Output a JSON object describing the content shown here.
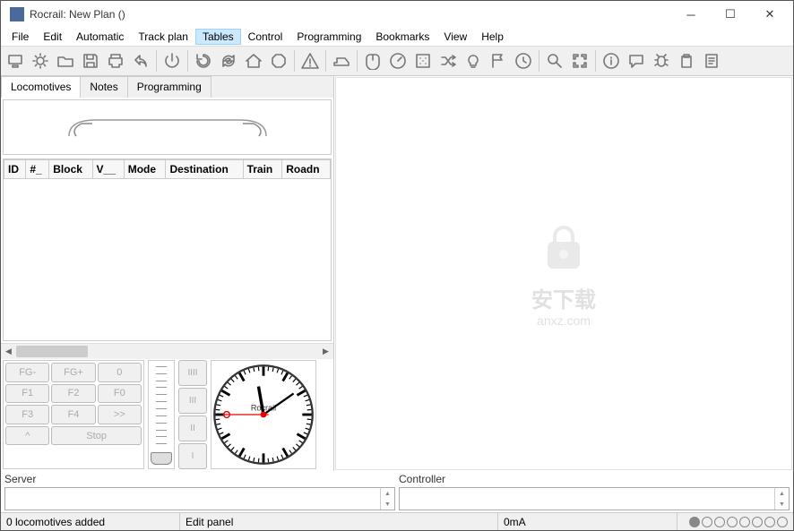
{
  "window": {
    "title": "Rocrail: New Plan ()"
  },
  "menu": {
    "items": [
      "File",
      "Edit",
      "Automatic",
      "Track plan",
      "Tables",
      "Control",
      "Programming",
      "Bookmarks",
      "View",
      "Help"
    ],
    "active_index": 4
  },
  "toolbar": {
    "icons": [
      "monitor-icon",
      "gears-icon",
      "open-icon",
      "save-icon",
      "print-icon",
      "undo-icon",
      "power-icon",
      "restart-icon",
      "sync-icon",
      "home-icon",
      "stop-icon",
      "warning-icon",
      "locomotive-icon",
      "mouse-icon",
      "gauge-icon",
      "dice-icon",
      "shuffle-icon",
      "light-icon",
      "flag-icon",
      "clock-icon",
      "zoom-icon",
      "fit-icon",
      "info-icon",
      "chat-icon",
      "bug-icon",
      "clipboard-icon",
      "notes-icon"
    ]
  },
  "tabs": {
    "items": [
      "Locomotives",
      "Notes",
      "Programming"
    ],
    "active_index": 0
  },
  "table": {
    "columns": [
      "ID",
      "#_",
      "Block",
      "V__",
      "Mode",
      "Destination",
      "Train",
      "Roadn"
    ]
  },
  "fn_buttons": {
    "fg_minus": "FG-",
    "fg_plus": "FG+",
    "zero": "0",
    "f1": "F1",
    "f2": "F2",
    "f0": "F0",
    "f3": "F3",
    "f4": "F4",
    "fwd": ">>",
    "caret": "^",
    "stop": "Stop"
  },
  "dir_buttons": [
    "IIII",
    "III",
    "II",
    "I"
  ],
  "clock": {
    "brand": "Rocrail"
  },
  "watermark": {
    "text": "安下载",
    "sub": "anxz.com"
  },
  "status_panels": {
    "server": "Server",
    "controller": "Controller"
  },
  "statusbar": {
    "locos": "0 locomotives added",
    "mode": "Edit panel",
    "current": "0mA",
    "dots_total": 8,
    "dots_filled": 1
  }
}
